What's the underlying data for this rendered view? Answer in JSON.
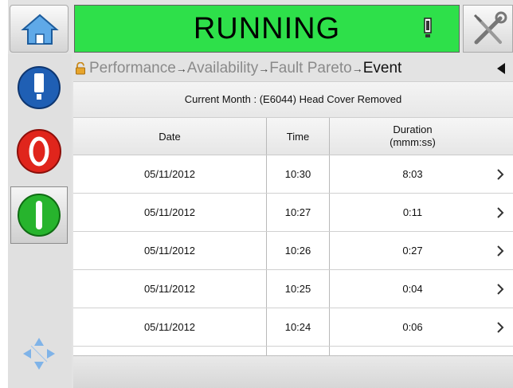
{
  "status": {
    "text": "RUNNING",
    "color": "#2ee04a"
  },
  "icons": {
    "home": "home-icon",
    "alert": "alert-icon",
    "tools": "tools-icon",
    "printhead": "printhead-icon",
    "stop": "stop-icon",
    "start": "start-icon",
    "navigate": "navigate-icon",
    "lock": "lock-icon",
    "back": "back-arrow-icon",
    "chevron": "chevron-right-icon"
  },
  "breadcrumb": {
    "items": [
      "Performance",
      "Availability",
      "Fault Pareto",
      "Event"
    ],
    "separator": "→"
  },
  "subtitle": "Current Month : (E6044) Head Cover Removed",
  "table": {
    "headers": {
      "date": "Date",
      "time": "Time",
      "duration": "Duration\n(mmm:ss)"
    },
    "rows": [
      {
        "date": "05/11/2012",
        "time": "10:30",
        "duration": "8:03"
      },
      {
        "date": "05/11/2012",
        "time": "10:27",
        "duration": "0:11"
      },
      {
        "date": "05/11/2012",
        "time": "10:26",
        "duration": "0:27"
      },
      {
        "date": "05/11/2012",
        "time": "10:25",
        "duration": "0:04"
      },
      {
        "date": "05/11/2012",
        "time": "10:24",
        "duration": "0:06"
      }
    ]
  }
}
